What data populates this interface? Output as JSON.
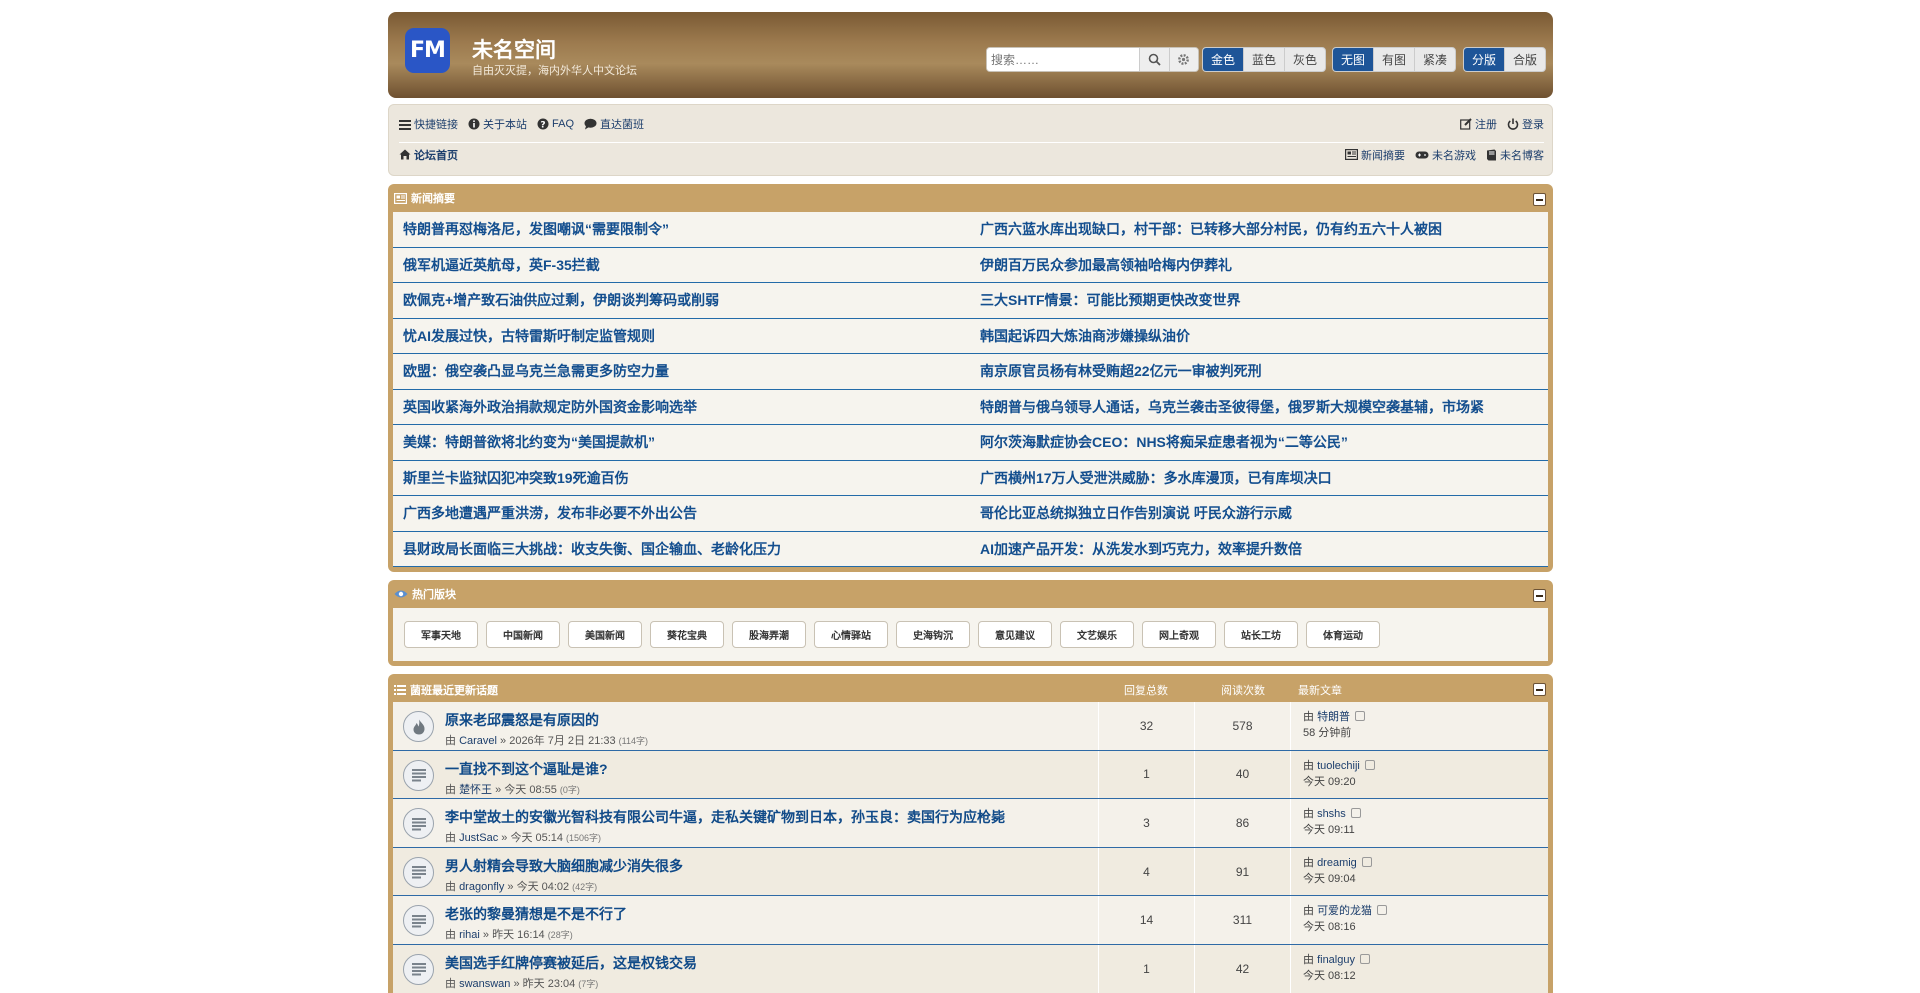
{
  "header": {
    "logo_text": "FM",
    "site_title": "未名空间",
    "site_desc": "自由灭灭提，海内外华人中文论坛",
    "search_placeholder": "搜索……",
    "color_group": [
      "金色",
      "蓝色",
      "灰色"
    ],
    "image_group": [
      "无图",
      "有图",
      "紧凑"
    ],
    "split_group": [
      "分版",
      "合版"
    ]
  },
  "nav": {
    "quick_links": "快捷链接",
    "about": "关于本站",
    "faq": "FAQ",
    "direct": "直达菌班",
    "register": "注册",
    "login": "登录",
    "home": "论坛首页",
    "news_digest": "新闻摘要",
    "games": "未名游戏",
    "blog": "未名博客"
  },
  "news": {
    "title": "新闻摘要",
    "left": [
      "特朗普再怼梅洛尼，发图嘲讽“需要限制令”",
      "俄军机逼近英航母，英F-35拦截",
      "欧佩克+增产致石油供应过剩，伊朗谈判筹码或削弱",
      "忧AI发展过快，古特雷斯吁制定监管规则",
      "欧盟：俄空袭凸显乌克兰急需更多防空力量",
      "英国收紧海外政治捐款规定防外国资金影响选举",
      "美媒：特朗普欲将北约变为“美国提款机”",
      "斯里兰卡监狱囚犯冲突致19死逾百伤",
      "广西多地遭遇严重洪涝，发布非必要不外出公告",
      "县财政局长面临三大挑战：收支失衡、国企输血、老龄化压力"
    ],
    "right": [
      "广西六蓝水库出现缺口，村干部：已转移大部分村民，仍有约五六十人被困",
      "伊朗百万民众参加最高领袖哈梅内伊葬礼",
      "三大SHTF情景：可能比预期更快改变世界",
      "韩国起诉四大炼油商涉嫌操纵油价",
      "南京原官员杨有林受贿超22亿元一审被判死刑",
      "特朗普与俄乌领导人通话，乌克兰袭击圣彼得堡，俄罗斯大规模空袭基辅，市场紧",
      "阿尔茨海默症协会CEO：NHS将痴呆症患者视为“二等公民”",
      "广西横州17万人受泄洪威胁：多水库漫顶，已有库坝决口",
      "哥伦比亚总统拟独立日作告别演说 吁民众游行示威",
      "AI加速产品开发：从洗发水到巧克力，效率提升数倍"
    ]
  },
  "hot": {
    "title": "热门版块",
    "forums": [
      "军事天地",
      "中国新闻",
      "美国新闻",
      "葵花宝典",
      "股海弄潮",
      "心情驿站",
      "史海钩沉",
      "意见建议",
      "文艺娱乐",
      "网上奇观",
      "站长工坊",
      "体育运动"
    ]
  },
  "topics": {
    "title": "菌班最近更新话题",
    "col_replies": "回复总数",
    "col_views": "阅读次数",
    "col_last": "最新文章",
    "by": "由",
    "rows": [
      {
        "title": "原来老邱震怒是有原因的",
        "author": "Caravel",
        "time": "» 2026年 7月 2日 21:33",
        "size": "(114字)",
        "replies": "32",
        "views": "578",
        "last_author": "特朗普",
        "last_time": "58 分钟前",
        "hot": true
      },
      {
        "title": "一直找不到这个逼耻是谁?",
        "author": "楚怀王",
        "time": "» 今天 08:55",
        "size": "(0字)",
        "replies": "1",
        "views": "40",
        "last_author": "tuolechiji",
        "last_time": "今天 09:20",
        "hot": false
      },
      {
        "title": "李中堂故土的安徽光智科技有限公司牛逼，走私关键矿物到日本，孙玉良：卖国行为应枪毙",
        "author": "JustSac",
        "time": "» 今天 05:14",
        "size": "(1506字)",
        "replies": "3",
        "views": "86",
        "last_author": "shshs",
        "last_time": "今天 09:11",
        "hot": false
      },
      {
        "title": "男人射精会导致大脑细胞减少消失很多",
        "author": "dragonfly",
        "time": "» 今天 04:02",
        "size": "(42字)",
        "replies": "4",
        "views": "91",
        "last_author": "dreamig",
        "last_time": "今天 09:04",
        "hot": false
      },
      {
        "title": "老张的黎曼猜想是不是不行了",
        "author": "rihai",
        "time": "» 昨天 16:14",
        "size": "(28字)",
        "replies": "14",
        "views": "311",
        "last_author": "可爱的龙猫",
        "last_time": "今天 08:16",
        "hot": false
      },
      {
        "title": "美国选手红牌停赛被延后，这是权钱交易",
        "author": "swanswan",
        "time": "» 昨天 23:04",
        "size": "(7字)",
        "replies": "1",
        "views": "42",
        "last_author": "finalguy",
        "last_time": "今天 08:12",
        "hot": false
      }
    ]
  }
}
